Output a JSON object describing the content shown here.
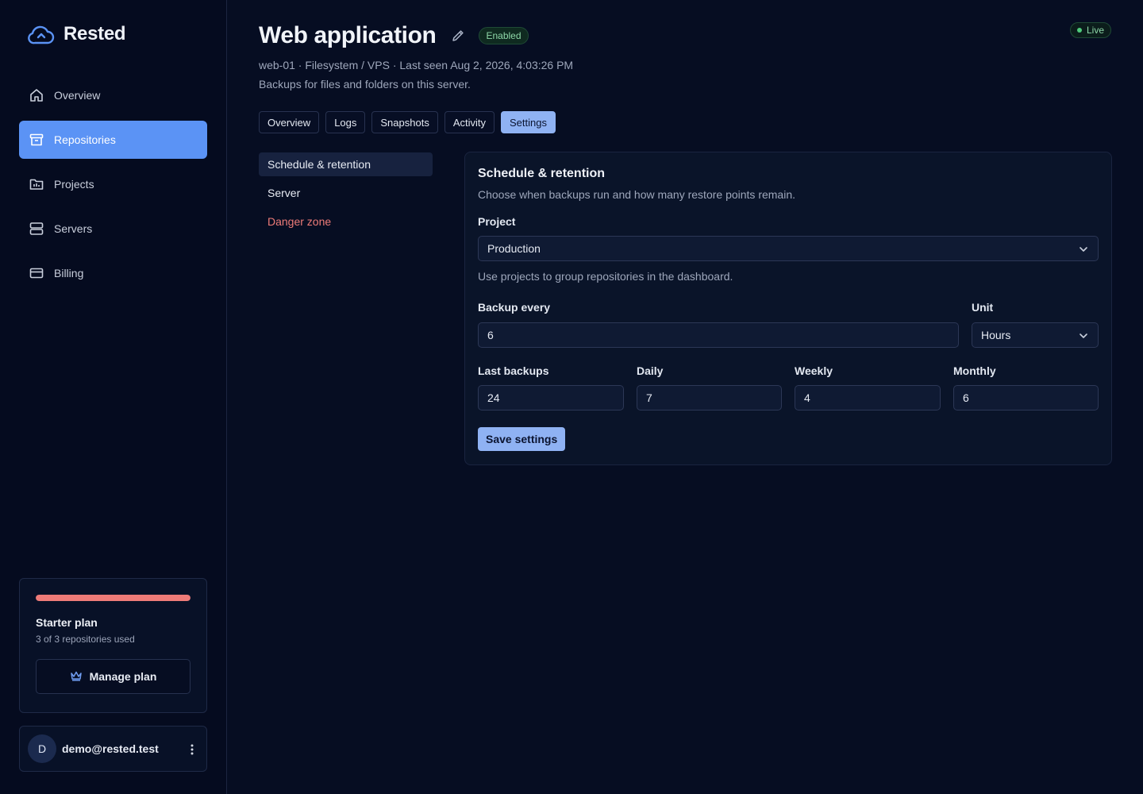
{
  "brand": {
    "name": "Rested"
  },
  "sidebar": {
    "items": [
      {
        "label": "Overview",
        "icon": "home-icon"
      },
      {
        "label": "Repositories",
        "icon": "archive-icon",
        "active": true
      },
      {
        "label": "Projects",
        "icon": "folder-chart-icon"
      },
      {
        "label": "Servers",
        "icon": "server-icon"
      },
      {
        "label": "Billing",
        "icon": "credit-card-icon"
      }
    ],
    "plan": {
      "name": "Starter plan",
      "usage_text": "3 of 3 repositories used",
      "usage_fraction": 1.0,
      "button_label": "Manage plan",
      "bar_color": "#ee7b78"
    },
    "user": {
      "initial": "D",
      "email": "demo@rested.test"
    }
  },
  "header": {
    "title": "Web application",
    "status_badge": "Enabled",
    "live_badge": "Live",
    "meta": "web-01 · Filesystem / VPS · Last seen Aug 2, 2026, 4:03:26 PM",
    "description": "Backups for files and folders on this server."
  },
  "tabs": [
    "Overview",
    "Logs",
    "Snapshots",
    "Activity",
    "Settings"
  ],
  "active_tab": "Settings",
  "settings_nav": [
    "Schedule & retention",
    "Server",
    "Danger zone"
  ],
  "panel": {
    "title": "Schedule & retention",
    "subtitle": "Choose when backups run and how many restore points remain.",
    "project_label": "Project",
    "project_value": "Production",
    "project_help": "Use projects to group repositories in the dashboard.",
    "backup_every_label": "Backup every",
    "backup_every_value": "6",
    "unit_label": "Unit",
    "unit_value": "Hours",
    "retention": [
      {
        "label": "Last backups",
        "value": "24"
      },
      {
        "label": "Daily",
        "value": "7"
      },
      {
        "label": "Weekly",
        "value": "4"
      },
      {
        "label": "Monthly",
        "value": "6"
      }
    ],
    "save_label": "Save settings"
  },
  "colors": {
    "accent": "#5b93f5",
    "accent_light": "#8fb2f3",
    "danger": "#ee7b78",
    "success": "#8ed8a8"
  }
}
